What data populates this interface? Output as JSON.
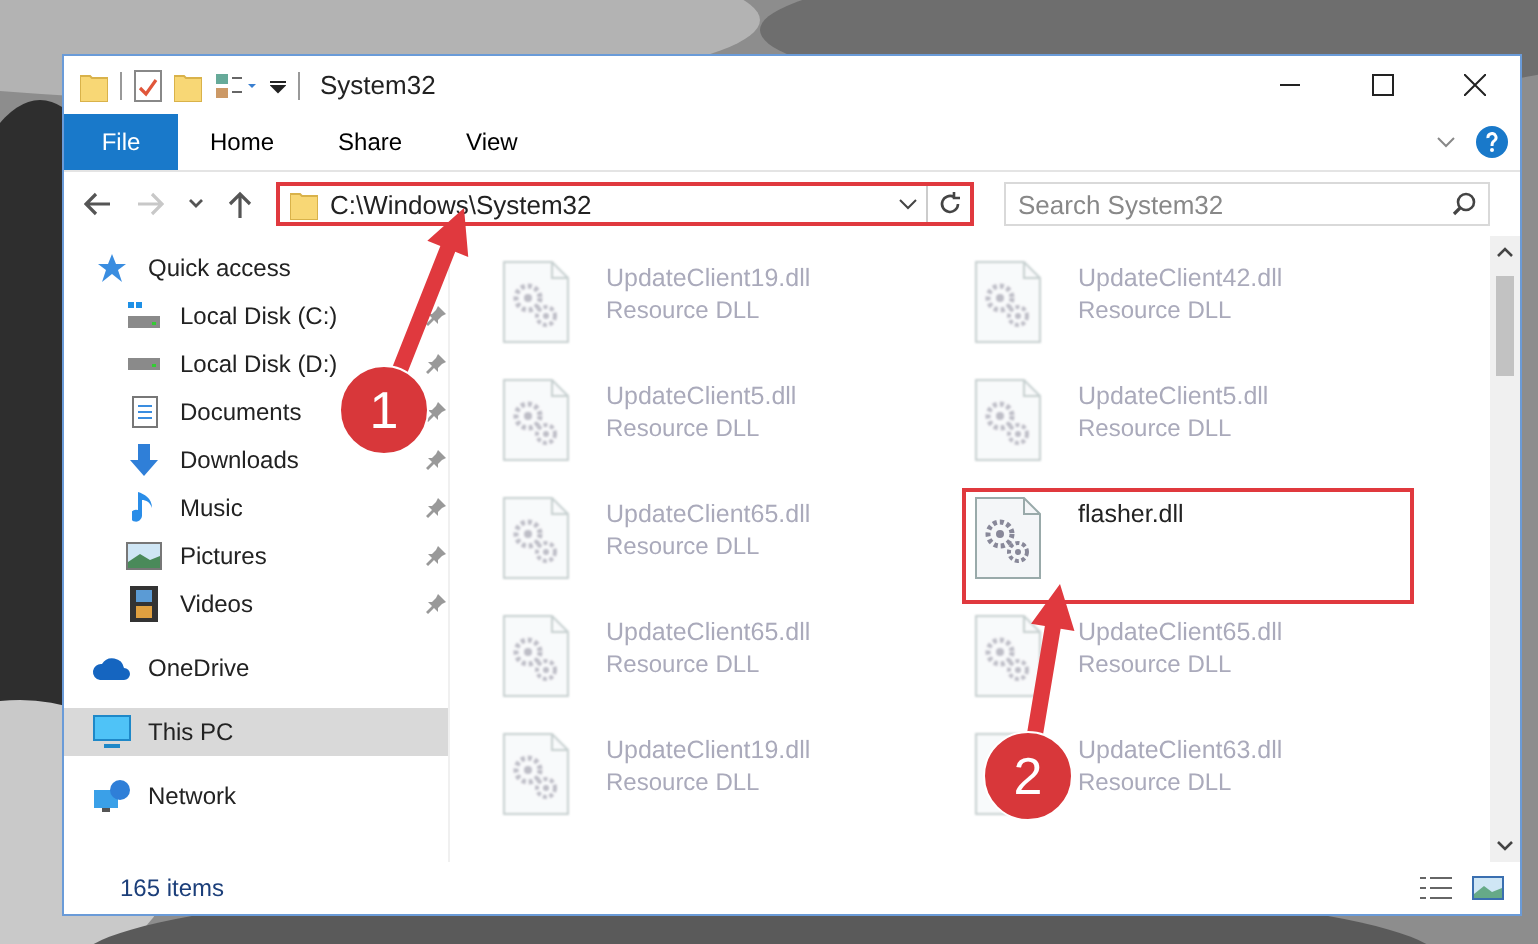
{
  "window": {
    "title": "System32"
  },
  "ribbon_tabs": [
    {
      "label": "File",
      "kind": "file"
    },
    {
      "label": "Home",
      "kind": "tab"
    },
    {
      "label": "Share",
      "kind": "tab"
    },
    {
      "label": "View",
      "kind": "tab"
    }
  ],
  "nav_buttons": [
    {
      "kind": "back",
      "disabled": false
    },
    {
      "kind": "forward",
      "disabled": true
    },
    {
      "kind": "recent",
      "disabled": false
    },
    {
      "kind": "up",
      "disabled": false
    }
  ],
  "address": {
    "path": "C:\\Windows\\System32",
    "annotated": true
  },
  "search": {
    "placeholder": "Search System32"
  },
  "sidebar": {
    "items": [
      {
        "label": "Quick access",
        "kind": "star",
        "selected": false,
        "children": [
          {
            "label": "Local Disk (C:)",
            "kind": "drive-c",
            "pinned": true,
            "selected": false
          },
          {
            "label": "Local Disk (D:)",
            "kind": "drive",
            "pinned": true,
            "selected": false
          },
          {
            "label": "Documents",
            "kind": "documents",
            "pinned": true,
            "selected": false
          },
          {
            "label": "Downloads",
            "kind": "downloads",
            "pinned": true,
            "selected": false
          },
          {
            "label": "Music",
            "kind": "music",
            "pinned": true,
            "selected": false
          },
          {
            "label": "Pictures",
            "kind": "pictures",
            "pinned": true,
            "selected": false
          },
          {
            "label": "Videos",
            "kind": "videos",
            "pinned": true,
            "selected": false
          }
        ]
      },
      {
        "label": "OneDrive",
        "kind": "cloud",
        "selected": false
      },
      {
        "label": "This PC",
        "kind": "pc",
        "selected": true
      },
      {
        "label": "Network",
        "kind": "network",
        "selected": false
      }
    ]
  },
  "files": [
    {
      "name": "UpdateClient19.dll",
      "type": "Resource DLL",
      "blurred": true,
      "annotated": false
    },
    {
      "name": "UpdateClient42.dll",
      "type": "Resource DLL",
      "blurred": true,
      "annotated": false
    },
    {
      "name": "UpdateClient5.dll",
      "type": "Resource DLL",
      "blurred": true,
      "annotated": false
    },
    {
      "name": "UpdateClient5.dll",
      "type": "Resource DLL",
      "blurred": true,
      "annotated": false
    },
    {
      "name": "UpdateClient65.dll",
      "type": "Resource DLL",
      "blurred": true,
      "annotated": false
    },
    {
      "name": "flasher.dll",
      "blurred": false,
      "annotated": true
    },
    {
      "name": "UpdateClient65.dll",
      "type": "Resource DLL",
      "blurred": true,
      "annotated": false
    },
    {
      "name": "UpdateClient65.dll",
      "type": "Resource DLL",
      "blurred": true,
      "annotated": false
    },
    {
      "name": "UpdateClient19.dll",
      "type": "Resource DLL",
      "blurred": true,
      "annotated": false
    },
    {
      "name": "UpdateClient63.dll",
      "type": "Resource DLL",
      "blurred": true,
      "annotated": false
    }
  ],
  "status_bar": {
    "item_count": "165 items"
  },
  "annotations": [
    {
      "label": "1"
    },
    {
      "label": "2"
    }
  ]
}
